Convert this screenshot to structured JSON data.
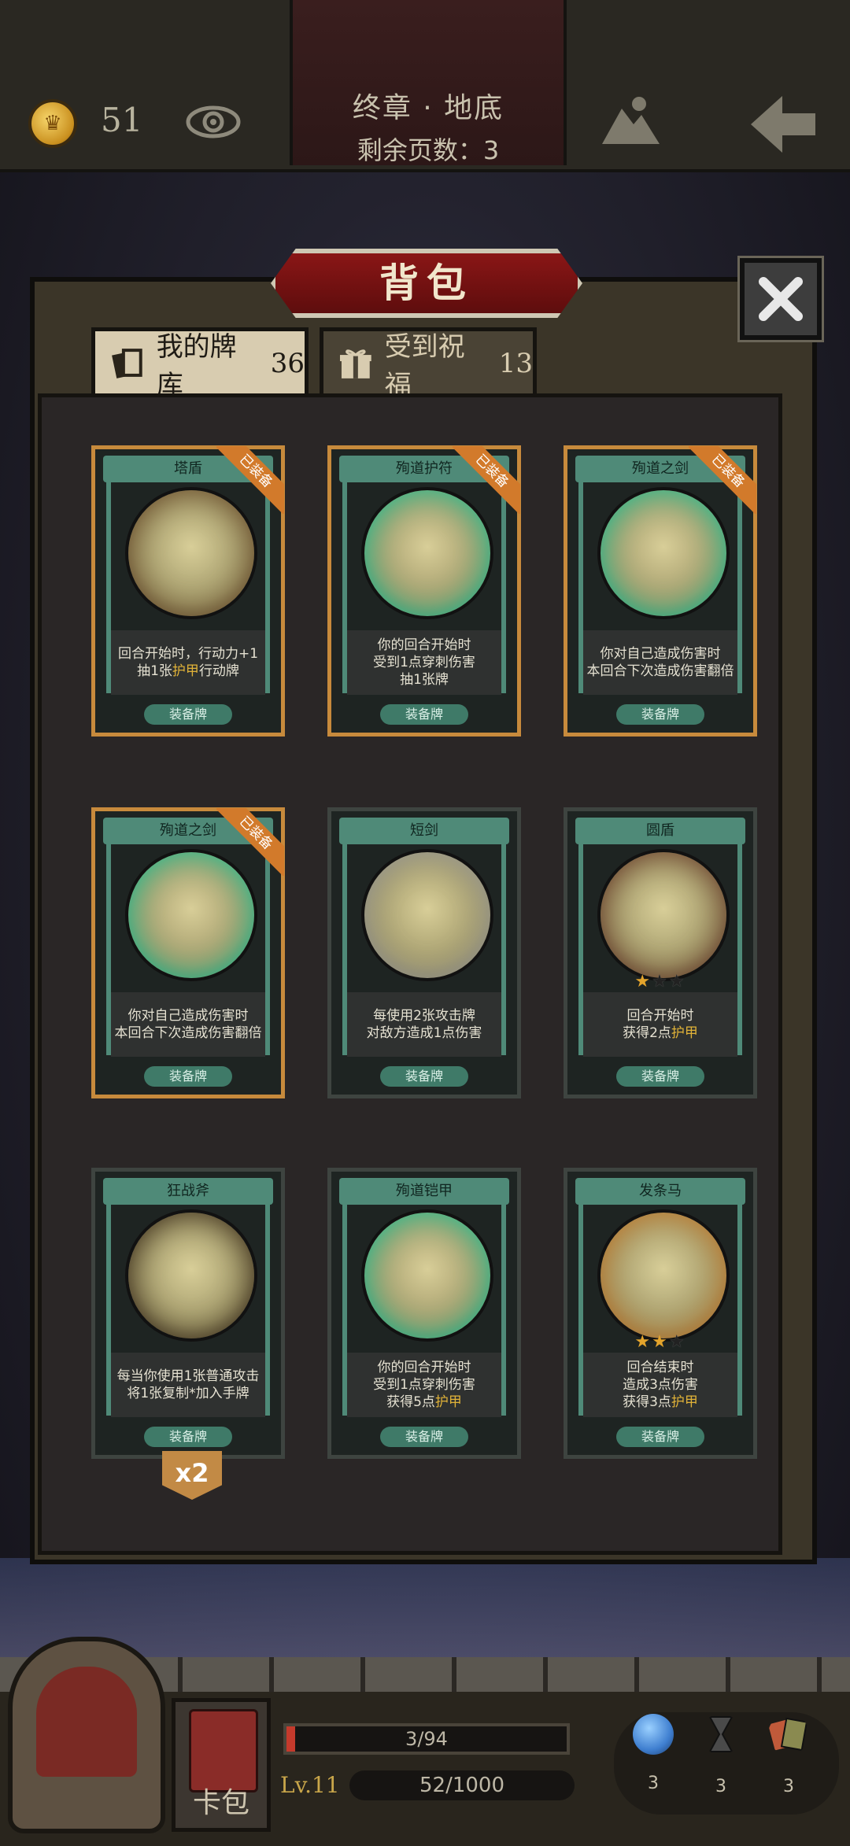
{
  "header": {
    "coins": "51",
    "chapter_title": "终章 · 地底",
    "pages_left": "剩余页数：3"
  },
  "panel": {
    "title": "背包",
    "tabs": [
      {
        "label": "我的牌库",
        "count": "36",
        "icon": "cards-icon"
      },
      {
        "label": "受到祝福",
        "count": "13",
        "icon": "gift-icon"
      }
    ]
  },
  "cards": [
    {
      "name": "塔盾",
      "equipped": true,
      "equipped_label": "已装备",
      "desc1": "回合开始时，行动力+1",
      "desc2_pre": "抽1张",
      "desc2_hl": "护甲",
      "desc2_post": "行动牌",
      "desc3": "",
      "tag": "装备牌",
      "stars": 0
    },
    {
      "name": "殉道护符",
      "equipped": true,
      "equipped_label": "已装备",
      "desc1": "你的回合开始时",
      "desc2_pre": "受到1点穿刺伤害",
      "desc2_hl": "",
      "desc2_post": "",
      "desc3": "抽1张牌",
      "tag": "装备牌",
      "stars": 0
    },
    {
      "name": "殉道之剑",
      "equipped": true,
      "equipped_label": "已装备",
      "desc1": "你对自己造成伤害时",
      "desc2_pre": "本回合下次造成伤害翻倍",
      "desc2_hl": "",
      "desc2_post": "",
      "desc3": "",
      "tag": "装备牌",
      "stars": 0
    },
    {
      "name": "殉道之剑",
      "equipped": true,
      "equipped_label": "已装备",
      "desc1": "你对自己造成伤害时",
      "desc2_pre": "本回合下次造成伤害翻倍",
      "desc2_hl": "",
      "desc2_post": "",
      "desc3": "",
      "tag": "装备牌",
      "stars": 0
    },
    {
      "name": "短剑",
      "equipped": false,
      "equipped_label": "",
      "desc1": "每使用2张攻击牌",
      "desc2_pre": "对敌方造成1点伤害",
      "desc2_hl": "",
      "desc2_post": "",
      "desc3": "",
      "tag": "装备牌",
      "stars": 0
    },
    {
      "name": "圆盾",
      "equipped": false,
      "equipped_label": "",
      "desc1": "回合开始时",
      "desc2_pre": "获得2点",
      "desc2_hl": "护甲",
      "desc2_post": "",
      "desc3": "",
      "tag": "装备牌",
      "stars": 1
    },
    {
      "name": "狂战斧",
      "equipped": false,
      "equipped_label": "",
      "desc1": "每当你使用1张普通攻击",
      "desc2_pre": "将1张复制*加入手牌",
      "desc2_hl": "",
      "desc2_post": "",
      "desc3": "",
      "tag": "装备牌",
      "stars": 0
    },
    {
      "name": "殉道铠甲",
      "equipped": false,
      "equipped_label": "",
      "desc1": "你的回合开始时",
      "desc2_pre": "受到1点穿刺伤害",
      "desc2_hl": "",
      "desc2_post": "",
      "desc3_pre": "获得5点",
      "desc3_hl": "护甲",
      "tag": "装备牌",
      "stars": 0
    },
    {
      "name": "发条马",
      "equipped": false,
      "equipped_label": "",
      "desc1": "回合结束时",
      "desc2_pre": "造成3点伤害",
      "desc2_hl": "",
      "desc2_post": "",
      "desc3_pre": "获得3点",
      "desc3_hl": "护甲",
      "tag": "装备牌",
      "stars": 2
    }
  ],
  "dup_badge": "x2",
  "hud": {
    "deck_label": "卡包",
    "hp_text": "3/94",
    "hp_fraction": 0.032,
    "level": "Lv.11",
    "xp_text": "52/1000",
    "resources": [
      {
        "icon": "potion-icon",
        "count": "3",
        "color": "#3f7fd0"
      },
      {
        "icon": "hourglass-icon",
        "count": "3",
        "color": "#4a4a4a"
      },
      {
        "icon": "card-stack-icon",
        "count": "3",
        "color": "#c05a3a"
      }
    ]
  }
}
